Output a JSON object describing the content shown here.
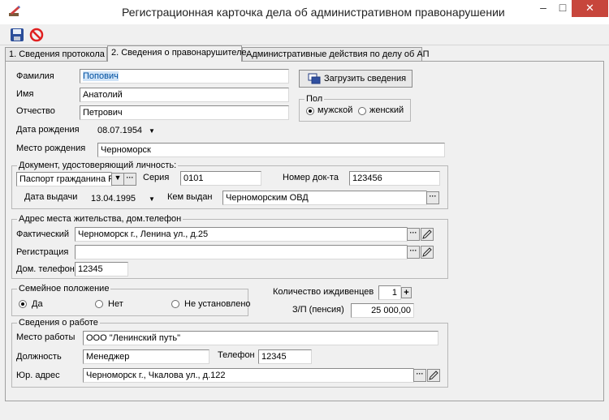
{
  "window": {
    "title": "Регистрационная карточка дела об административном правонарушении",
    "minimize_glyph": "–",
    "maximize_glyph": "□",
    "close_glyph": "✕"
  },
  "toolbar": {
    "save_icon": "floppy-disk-icon",
    "cancel_icon": "no-entry-icon"
  },
  "tabs": [
    {
      "label": "1. Сведения протокола",
      "active": false
    },
    {
      "label": "2. Сведения о правонарушителе",
      "active": true
    },
    {
      "label": "Административные действия по делу об АП",
      "active": false
    }
  ],
  "person": {
    "surname_label": "Фамилия",
    "surname_value": "Попович",
    "name_label": "Имя",
    "name_value": "Анатолий",
    "patronymic_label": "Отчество",
    "patronymic_value": "Петрович",
    "birthdate_label": "Дата рождения",
    "birthdate_value": "08.07.1954",
    "birthplace_label": "Место рождения",
    "birthplace_value": "Черноморск",
    "load_button_label": "Загрузить сведения",
    "gender": {
      "legend": "Пол",
      "male_label": "мужской",
      "female_label": "женский",
      "selected": "male"
    }
  },
  "document": {
    "legend": "Документ, удостоверяющий личность:",
    "type_value": "Паспорт гражданина РФ",
    "series_label": "Серия",
    "series_value": "0101",
    "number_label": "Номер док-та",
    "number_value": "123456",
    "issue_date_label": "Дата выдачи",
    "issue_date_value": "13.04.1995",
    "issued_by_label": "Кем выдан",
    "issued_by_value": "Черноморским ОВД"
  },
  "address": {
    "legend": "Адрес места жительства, дом.телефон",
    "actual_label": "Фактический",
    "actual_value": "Черноморск г., Ленина ул., д.25",
    "registration_label": "Регистрация",
    "registration_value": "",
    "phone_label": "Дом. телефон",
    "phone_value": "12345"
  },
  "family": {
    "legend": "Семейное положение",
    "yes_label": "Да",
    "no_label": "Нет",
    "unknown_label": "Не установлено",
    "selected": "yes",
    "dependents_label": "Количество иждивенцев",
    "dependents_value": "1",
    "salary_label": "З/П (пенсия)",
    "salary_value": "25 000,00"
  },
  "work": {
    "legend": "Сведения о работе",
    "place_label": "Место работы",
    "place_value": "ООО \"Ленинский путь\"",
    "position_label": "Должность",
    "position_value": "Менеджер",
    "phone_label": "Телефон",
    "phone_value": "12345",
    "legal_address_label": "Юр. адрес",
    "legal_address_value": "Черноморск г., Чкалова ул., д.122"
  }
}
